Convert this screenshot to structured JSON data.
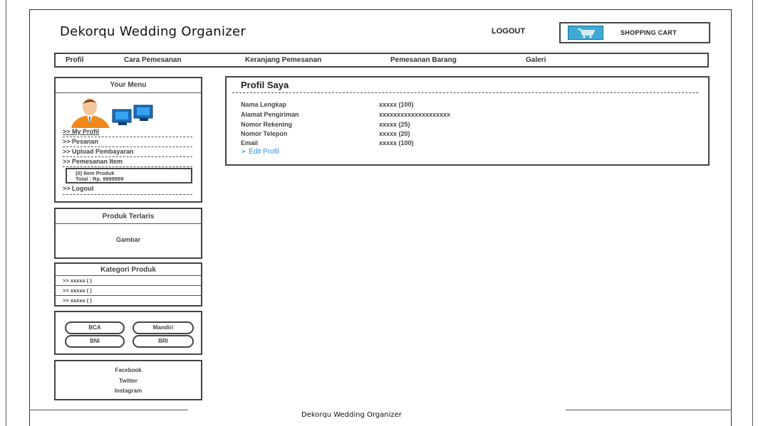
{
  "header": {
    "site_title": "Dekorqu Wedding Organizer",
    "logout_label": "LOGOUT",
    "cart_label": "SHOPPING CART",
    "cart_icon": "shopping-cart-icon"
  },
  "nav": {
    "items": [
      "Profil",
      "Cara Pemesanan",
      "Keranjang Pemesanan",
      "Pemesanan Barang",
      "Galeri"
    ]
  },
  "sidebar": {
    "menu_title": "Your Menu",
    "avatar_icon": "user-computer-icon",
    "links": [
      ">> My Profil",
      ">> Pesanan",
      ">> Upload Pembayaran",
      ">> Pemesanan Item"
    ],
    "cart_summary": [
      "(0) Item Produk",
      "Total : Rp. 9999999"
    ],
    "logout_link": ">> Logout",
    "produk_title": "Produk Terlaris",
    "produk_image": "Gambar",
    "kategori_title": "Kategori Produk",
    "kategori_items": [
      ">> xxxxx ( )",
      ">> xxxxx ( )",
      ">> xxxxx ( )"
    ],
    "banks": [
      "BCA",
      "Mandiri",
      "BNI",
      "BRI"
    ],
    "social": [
      "Facebook",
      "Twitter",
      "Instagram"
    ]
  },
  "profile": {
    "title": "Profil Saya",
    "fields": [
      {
        "label": "Nama Lengkap",
        "value": "xxxxx (100)"
      },
      {
        "label": "Alamat Pengiriman",
        "value": "xxxxxxxxxxxxxxxxxxxx"
      },
      {
        "label": "Nomor Rekening",
        "value": "xxxxx (25)"
      },
      {
        "label": "Nomor Telepon",
        "value": "xxxxx (20)"
      },
      {
        "label": "Email",
        "value": "xxxxx (100)"
      }
    ],
    "edit_link": "➢ Edit Profil"
  },
  "footer": {
    "text": "Dekorqu Wedding Organizer"
  },
  "colors": {
    "cart_icon_bg": "#3fa9d6",
    "link_blue": "#2b8fd8",
    "border": "#444444"
  }
}
